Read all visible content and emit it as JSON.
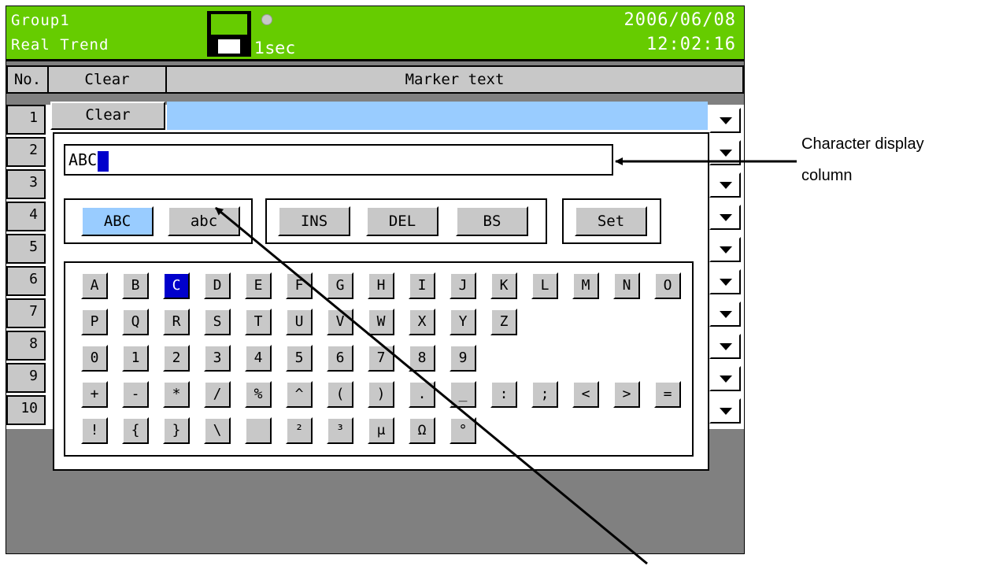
{
  "top_bar": {
    "group": "Group1",
    "mode": "Real Trend",
    "interval": "1sec",
    "date": "2006/06/08",
    "time": "12:02:16"
  },
  "table_header": {
    "no": "No.",
    "clear": "Clear",
    "marker_text": "Marker text"
  },
  "rows": [
    "1",
    "2",
    "3",
    "4",
    "5",
    "6",
    "7",
    "8",
    "9",
    "10"
  ],
  "row1_clear_button": "Clear",
  "dialog": {
    "display_text": "ABC",
    "case_buttons": {
      "upper": "ABC",
      "lower": "abc"
    },
    "edit_buttons": {
      "ins": "INS",
      "del": "DEL",
      "bs": "BS"
    },
    "set_button": "Set",
    "keyboard_rows": [
      [
        "A",
        "B",
        "C",
        "D",
        "E",
        "F",
        "G",
        "H",
        "I",
        "J",
        "K",
        "L",
        "M",
        "N",
        "O"
      ],
      [
        "P",
        "Q",
        "R",
        "S",
        "T",
        "U",
        "V",
        "W",
        "X",
        "Y",
        "Z"
      ],
      [
        "0",
        "1",
        "2",
        "3",
        "4",
        "5",
        "6",
        "7",
        "8",
        "9"
      ],
      [
        "+",
        "-",
        "*",
        "/",
        "%",
        "^",
        "(",
        ")",
        ".",
        "_",
        ":",
        ";",
        "<",
        ">",
        "="
      ],
      [
        "!",
        "{",
        "}",
        "\\",
        " ",
        "²",
        "³",
        "μ",
        "Ω",
        "°"
      ]
    ],
    "selected_key": "C"
  },
  "annotation": {
    "line1": "Character display",
    "line2": "column"
  },
  "colors": {
    "title_bar": "#66cc00",
    "selected": "#99ccff",
    "cursor": "#0000cc"
  }
}
